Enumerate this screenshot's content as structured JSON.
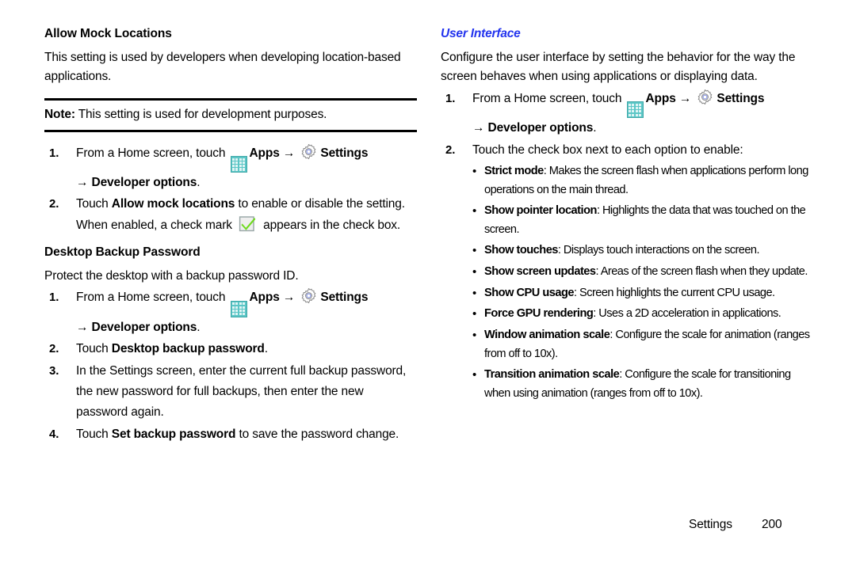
{
  "document": {
    "footer": {
      "label": "Settings",
      "page_number": "200"
    }
  },
  "icons": {
    "apps": "apps-grid-icon",
    "settings": "gear-icon",
    "check": "green-check-icon",
    "arrow": "→"
  },
  "left_column": {
    "section_1": {
      "heading": "Allow Mock Locations",
      "intro": "This setting is used by developers when developing location-based applications.",
      "note": {
        "label": "Note:",
        "text": " This setting is used for development purposes."
      },
      "steps": [
        {
          "num": "1.",
          "lead": "From a Home screen, touch ",
          "apps_label": "Apps",
          "settings_label": "Settings",
          "sub_arrow_label": "Developer options",
          "sub_tail": "."
        },
        {
          "num": "2.",
          "lead": "Touch ",
          "bold": "Allow mock locations",
          "tail": " to enable or disable the setting.",
          "extra_before": "When enabled, a check mark ",
          "extra_after": " appears in the check box."
        }
      ]
    },
    "section_2": {
      "heading": "Desktop Backup Password",
      "intro": "Protect the desktop with a backup password ID.",
      "steps": [
        {
          "num": "1.",
          "lead": "From a Home screen, touch ",
          "apps_label": "Apps",
          "settings_label": "Settings",
          "sub_arrow_label": "Developer options",
          "sub_tail": "."
        },
        {
          "num": "2.",
          "lead": "Touch ",
          "bold": "Desktop backup password",
          "tail": "."
        },
        {
          "num": "3.",
          "lead": "In the Settings screen, enter the current full backup password, the new password for full backups, then enter the new password again."
        },
        {
          "num": "4.",
          "lead": "Touch ",
          "bold": "Set backup password",
          "tail": " to save the password change."
        }
      ]
    }
  },
  "right_column": {
    "heading": "User Interface",
    "heading_color": "#2233EE",
    "intro": "Configure the user interface by setting the behavior for the way the screen behaves when using applications or displaying data.",
    "steps": [
      {
        "num": "1.",
        "lead": "From a Home screen, touch ",
        "apps_label": "Apps",
        "settings_label": "Settings",
        "sub_arrow_label": "Developer options",
        "sub_tail": "."
      },
      {
        "num": "2.",
        "lead": "Touch the check box next to each option to enable:"
      }
    ],
    "bullets": [
      {
        "term": "Strict mode",
        "desc": ": Makes the screen flash when applications perform long operations on the main thread."
      },
      {
        "term": "Show pointer location",
        "desc": ": Highlights the data that was touched on the screen."
      },
      {
        "term": "Show touches",
        "desc": ": Displays touch interactions on the screen."
      },
      {
        "term": "Show screen updates",
        "desc": ": Areas of the screen flash when they update."
      },
      {
        "term": "Show CPU usage",
        "desc": ": Screen highlights the current CPU usage."
      },
      {
        "term": "Force GPU rendering",
        "desc": ": Uses a 2D acceleration in applications."
      },
      {
        "term": "Window animation scale",
        "desc": ": Configure the scale for animation (ranges from off to 10x)."
      },
      {
        "term": "Transition animation scale",
        "desc": ": Configure the scale for transitioning when using animation (ranges from off to 10x)."
      }
    ]
  }
}
